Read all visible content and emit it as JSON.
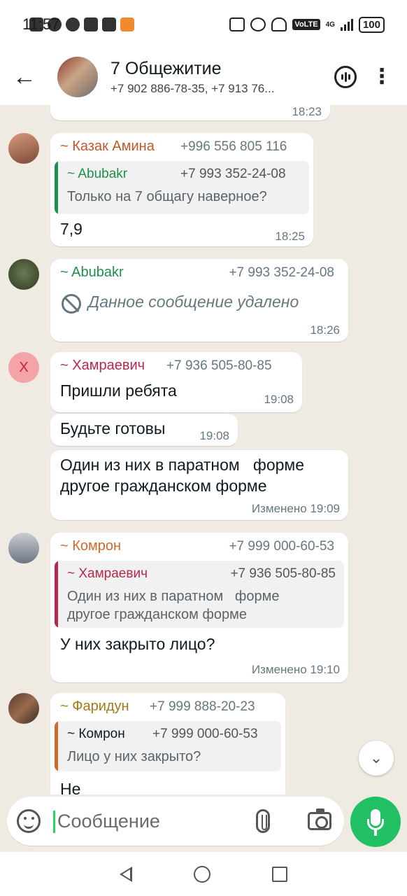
{
  "status_bar": {
    "time": "11:57",
    "network": "VoLTE",
    "network_gen": "4G",
    "battery": "100"
  },
  "header": {
    "title": "7 Общежитие",
    "subtitle": "+7 902 886-78-35, +7 913 76..."
  },
  "messages": [
    {
      "time": "18:23"
    },
    {
      "sender": "~ Казак Амина",
      "phone": "+996 556 805 116",
      "quote": {
        "sender": "~ Abubakr",
        "phone": "+7 993 352-24-08",
        "text": "Только на 7 общагу наверное?"
      },
      "text": "7,9",
      "time": "18:25"
    },
    {
      "sender": "~ Abubakr",
      "phone": "+7 993 352-24-08",
      "text": "Данное сообщение удалено",
      "time": "18:26"
    },
    {
      "avatar_letter": "X",
      "sender": "~ Хамраевич",
      "phone": "+7 936 505-80-85",
      "text": "Пришли ребята",
      "time": "19:08"
    },
    {
      "text": "Будьте готовы",
      "time": "19:08"
    },
    {
      "text_line1": "Один из них в паратном   форме",
      "text_line2": "другое гражданском форме",
      "time": "Изменено 19:09"
    },
    {
      "sender": "~ Комрон",
      "phone": "+7 999 000-60-53",
      "quote": {
        "sender": "~ Хамраевич",
        "phone": "+7 936 505-80-85",
        "text_line1": "Один из них в паратном   форме",
        "text_line2": "другое гражданском форме"
      },
      "text": "У них закрыто лицо?",
      "time": "Изменено 19:10"
    },
    {
      "sender": "~ Фаридун",
      "phone": "+7 999 888-20-23",
      "quote": {
        "sender": "~ Комрон",
        "phone": "+7 999 000-60-53",
        "text": "Лицо у них закрыто?"
      },
      "text": "Не"
    }
  ],
  "composer": {
    "placeholder": "Сообщение"
  },
  "colors": {
    "chat_bg": "#efeae2",
    "accent_green": "#21c063",
    "sender_kazak": "#c0582b",
    "sender_abubakr": "#1f8f4e",
    "sender_khamraevich": "#b5294a",
    "sender_komron": "#d2692a",
    "sender_faridun": "#a67a17"
  },
  "icons": [
    "back-arrow-icon",
    "voice-chat-icon",
    "more-vert-icon",
    "deleted-icon",
    "scroll-down-icon",
    "sticker-icon",
    "attach-icon",
    "camera-icon",
    "mic-icon"
  ]
}
